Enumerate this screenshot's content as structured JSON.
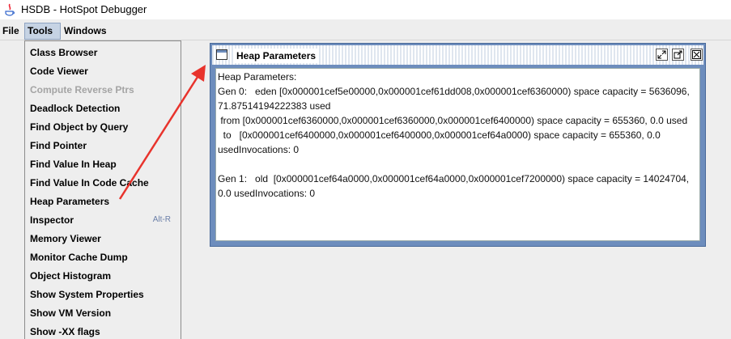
{
  "window": {
    "title": "HSDB - HotSpot Debugger"
  },
  "menubar": {
    "file": "File",
    "tools": "Tools",
    "windows": "Windows"
  },
  "tools_menu": {
    "items": [
      {
        "label": "Class Browser"
      },
      {
        "label": "Code Viewer"
      },
      {
        "label": "Compute Reverse Ptrs",
        "disabled": true
      },
      {
        "label": "Deadlock Detection"
      },
      {
        "label": "Find Object by Query"
      },
      {
        "label": "Find Pointer"
      },
      {
        "label": "Find Value In Heap"
      },
      {
        "label": "Find Value In Code Cache"
      },
      {
        "label": "Heap Parameters"
      },
      {
        "label": "Inspector",
        "accelerator": "Alt-R"
      },
      {
        "label": "Memory Viewer"
      },
      {
        "label": "Monitor Cache Dump"
      },
      {
        "label": "Object Histogram"
      },
      {
        "label": "Show System Properties"
      },
      {
        "label": "Show VM Version"
      },
      {
        "label": "Show -XX flags"
      }
    ]
  },
  "heap_window": {
    "title": "Heap Parameters",
    "lines": [
      "Heap Parameters:",
      "Gen 0:   eden [0x000001cef5e00000,0x000001cef61dd008,0x000001cef6360000) space capacity = 5636096,",
      "71.87514194222383 used",
      " from [0x000001cef6360000,0x000001cef6360000,0x000001cef6400000) space capacity = 655360, 0.0 used",
      "  to   [0x000001cef6400000,0x000001cef6400000,0x000001cef64a0000) space capacity = 655360, 0.0",
      "usedInvocations: 0",
      "",
      "Gen 1:   old  [0x000001cef64a0000,0x000001cef64a0000,0x000001cef7200000) space capacity = 14024704,",
      "0.0 usedInvocations: 0"
    ]
  },
  "colors": {
    "annotation_arrow": "#e8332c",
    "frame_border": "#6d8dbd"
  }
}
